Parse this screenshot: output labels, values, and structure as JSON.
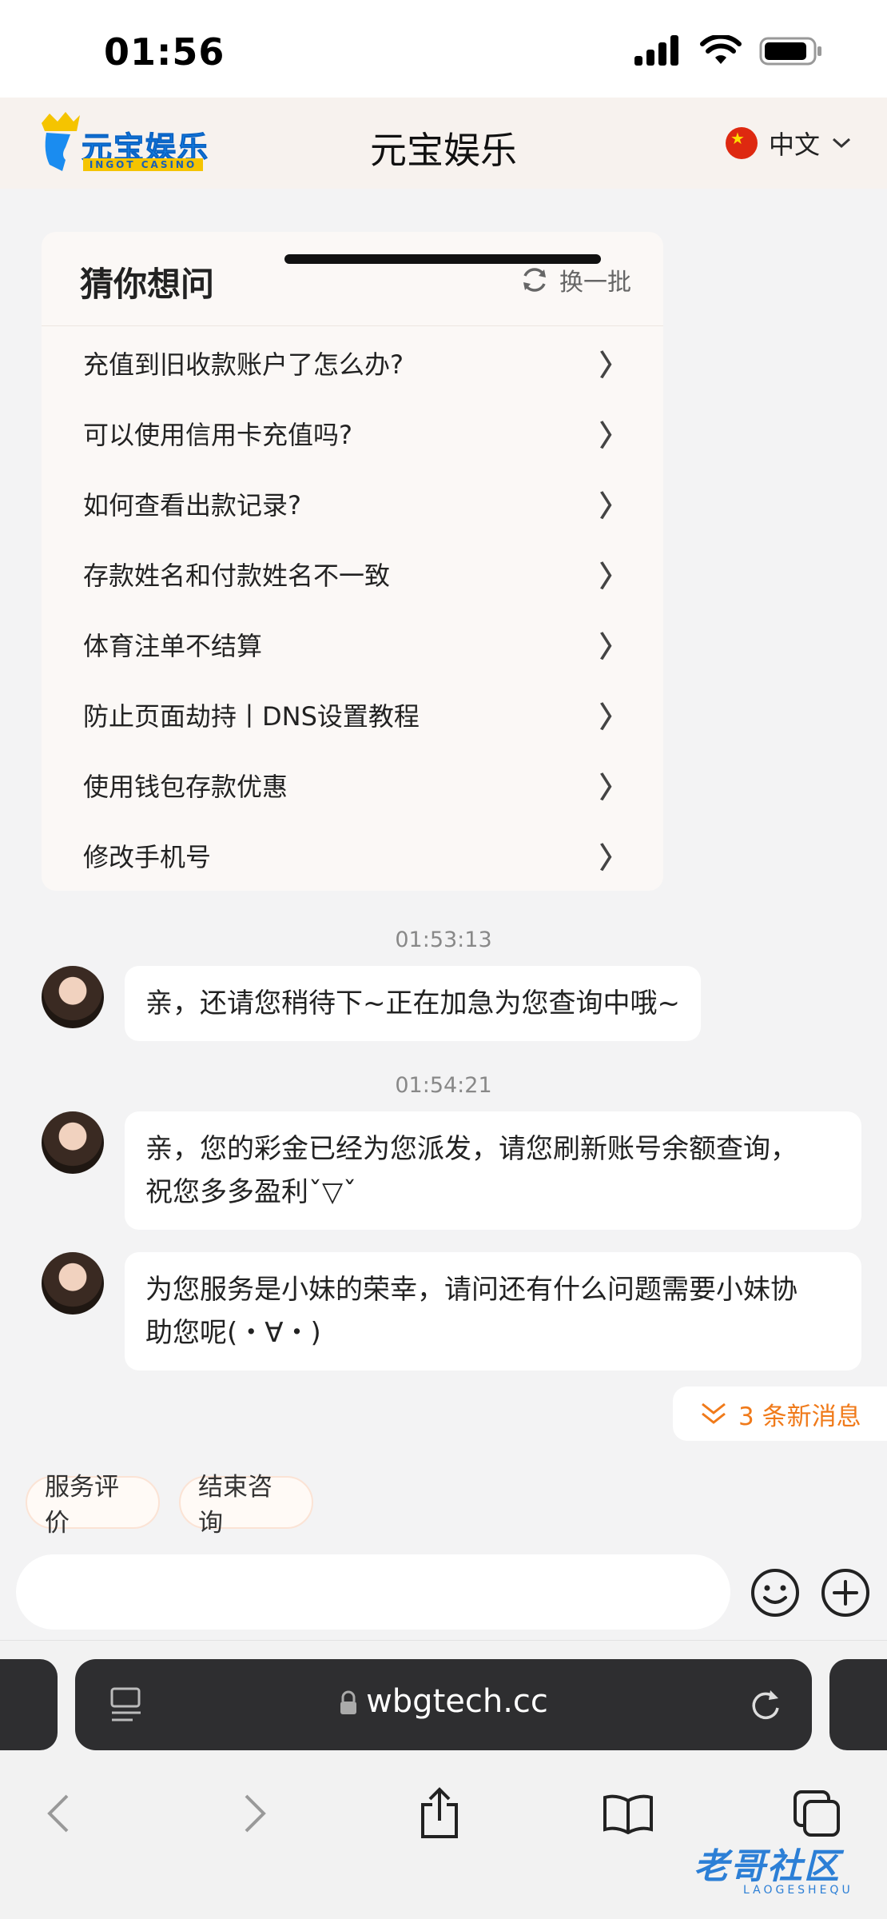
{
  "status_bar": {
    "time": "01:56"
  },
  "header": {
    "logo_text": "元宝娱乐",
    "logo_sub": "INGOT CASINO",
    "title": "元宝娱乐",
    "language": "中文"
  },
  "faq": {
    "title": "猜你想问",
    "refresh_label": "换一批",
    "items": [
      "充值到旧收款账户了怎么办?",
      "可以使用信用卡充值吗?",
      "如何查看出款记录?",
      "存款姓名和付款姓名不一致",
      "体育注单不结算",
      "防止页面劫持丨DNS设置教程",
      "使用钱包存款优惠",
      "修改手机号"
    ]
  },
  "chat": {
    "messages": [
      {
        "time": "01:53:13",
        "text": "亲，还请您稍待下~正在加急为您查询中哦~"
      },
      {
        "time": "01:54:21",
        "line1": "亲，您的彩金已经为您派发，请您刷新账号余额查询，",
        "line2": "祝您多多盈利ˇ▽ˇ"
      },
      {
        "line1": "为您服务是小妹的荣幸，请问还有什么问题需要小妹协",
        "line2": "助您呢(・∀・)"
      }
    ],
    "new_messages": "3 条新消息"
  },
  "quick_actions": {
    "rate": "服务评价",
    "end": "结束咨询"
  },
  "input": {
    "placeholder": ""
  },
  "browser": {
    "url": "wbgtech.cc"
  },
  "watermark": {
    "text": "老哥社区",
    "sub": "LAOGESHEQU"
  }
}
